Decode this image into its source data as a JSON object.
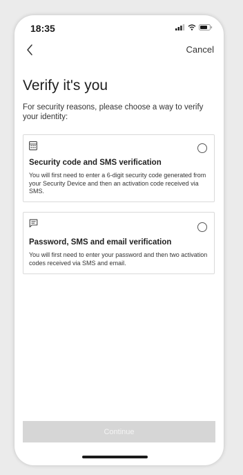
{
  "status_bar": {
    "time": "18:35",
    "icons": [
      "signal-icon",
      "wifi-icon",
      "battery-icon"
    ]
  },
  "nav": {
    "back_icon": "chevron-left-icon",
    "cancel_label": "Cancel"
  },
  "page": {
    "title": "Verify it's you",
    "subtitle": "For security reasons, please choose a way to verify your identity:"
  },
  "options": [
    {
      "icon": "calculator-icon",
      "title": "Security code and SMS verification",
      "description": "You will first need to enter a 6-digit security code generated from your Security Device and then an activation code received via SMS.",
      "selected": false
    },
    {
      "icon": "message-icon",
      "title": "Password, SMS and email verification",
      "description": "You will first need to enter your password and then two activation codes received via SMS and email.",
      "selected": false
    }
  ],
  "continue": {
    "label": "Continue",
    "enabled": false
  },
  "colors": {
    "button_disabled_bg": "#d6d6d6",
    "button_disabled_text": "#f4f4f4",
    "card_border": "#d9d9d9",
    "text_primary": "#1f1f1f"
  }
}
